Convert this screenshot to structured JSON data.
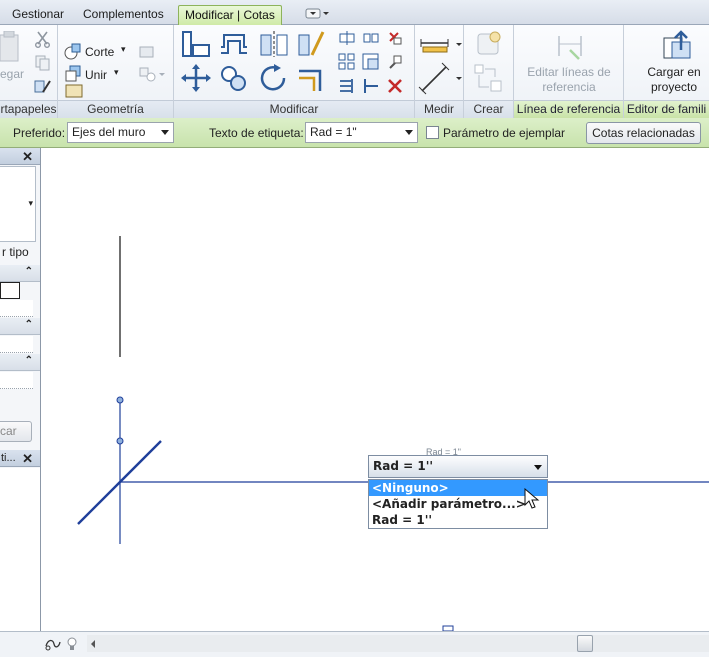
{
  "tabs": [
    {
      "label": "Gestionar",
      "active": false
    },
    {
      "label": "Complementos",
      "active": false
    },
    {
      "label": "Modificar | Cotas",
      "active": true
    }
  ],
  "ribbon": {
    "panels": {
      "portapapeles": "rtapapeles",
      "geometria": "Geometría",
      "modificar": "Modificar",
      "medir": "Medir",
      "crear": "Crear",
      "linea_referencia": "Línea de referencia",
      "editor_familia": "Editor de famili"
    },
    "clipboard_partial_label": "egar",
    "corte_label": "Corte",
    "unir_label": "Unir",
    "editar_lineas_label": "Editar líneas de referencia",
    "cargar_label": "Cargar en proyecto"
  },
  "options_bar": {
    "preferido_label": "Preferido:",
    "preferido_value": "Ejes del muro",
    "texto_etiqueta_label": "Texto de etiqueta:",
    "texto_etiqueta_value": "Rad = 1\"",
    "parametro_label": "Parámetro de ejemplar",
    "cotas_button": "Cotas relacionadas"
  },
  "left_panel": {
    "tipo_partial": "r tipo",
    "button_partial": "car",
    "second_title_partial": "ti..."
  },
  "canvas": {
    "dimension_ghost_text": "Rad = 1\"",
    "dropdown": {
      "selected": "Rad = 1''",
      "options": [
        "<Ninguno>",
        "<Añadir parámetro...>",
        "Rad = 1''"
      ],
      "highlighted_index": 0
    }
  },
  "colors": {
    "accent_green": "#cfeaa7",
    "selection_blue": "#3399ff",
    "element_blue": "#1f3f9a"
  }
}
